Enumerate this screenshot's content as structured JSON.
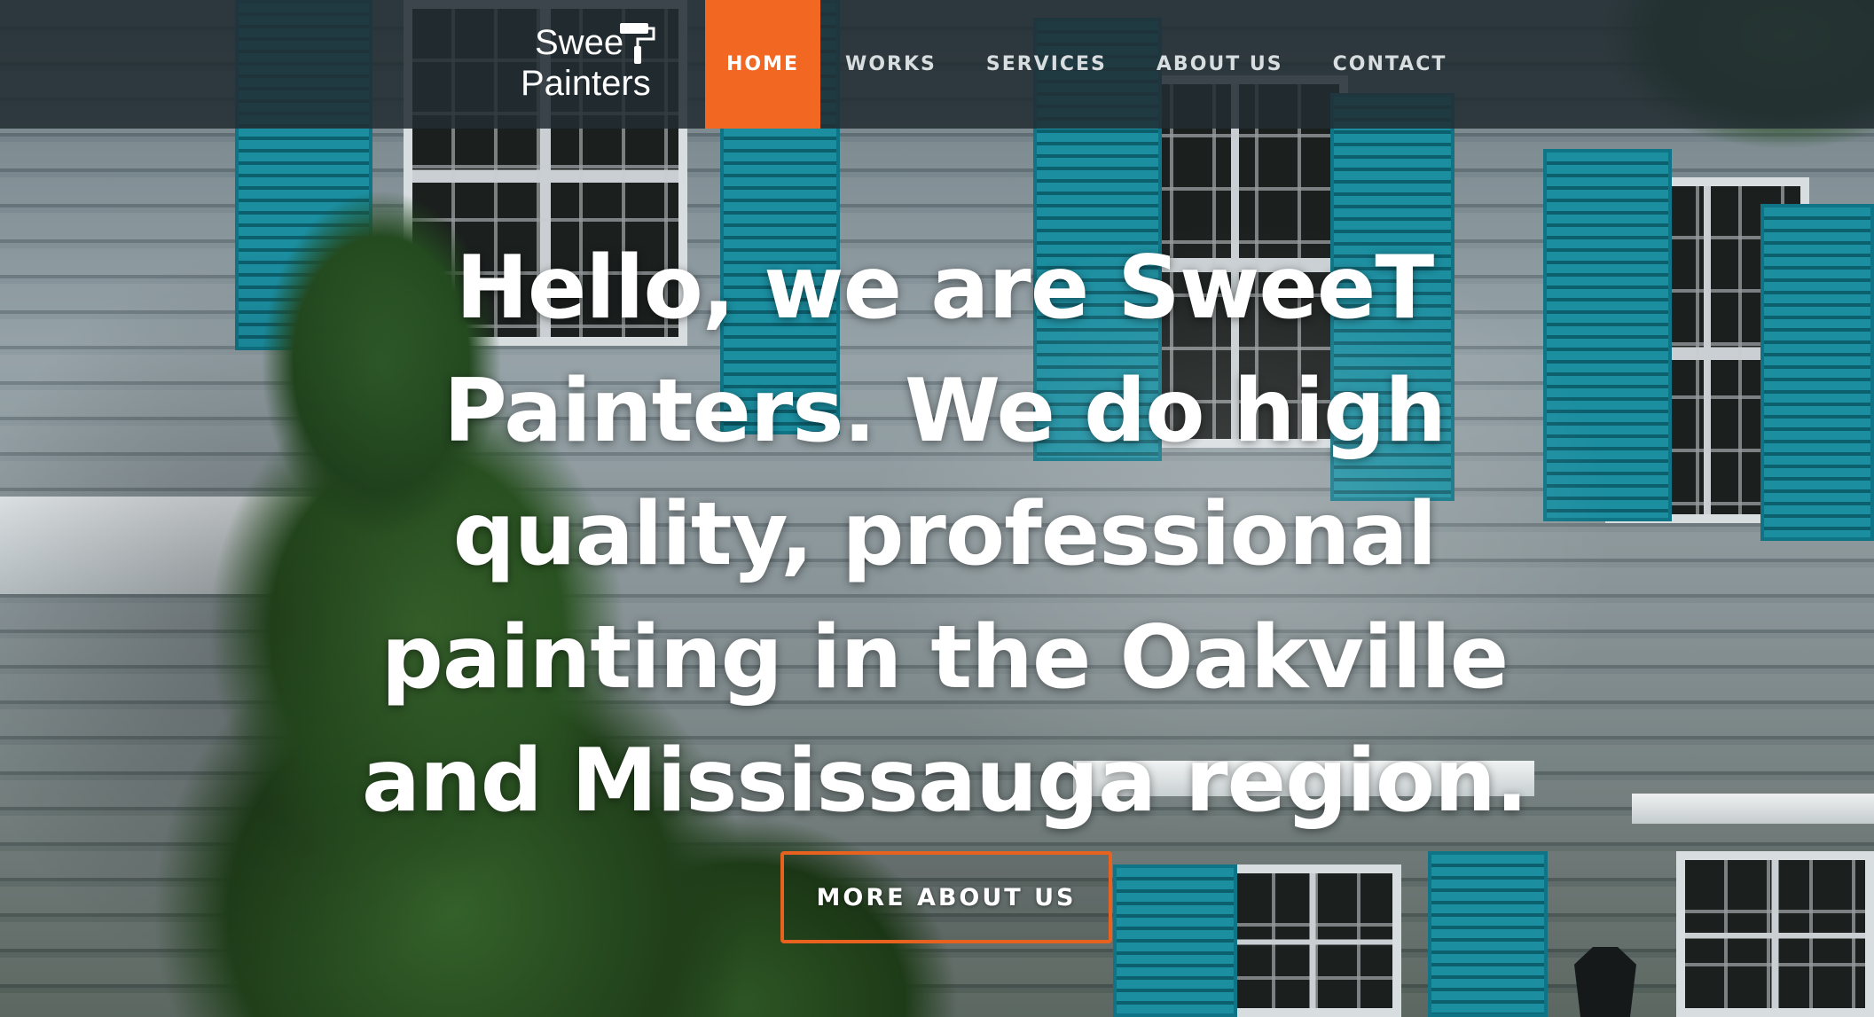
{
  "brand": {
    "name_line1": "Swee",
    "name_line2": "Painters",
    "logo_icon": "paint-roller-icon"
  },
  "nav": {
    "items": [
      {
        "label": "HOME",
        "active": true
      },
      {
        "label": "WORKS",
        "active": false
      },
      {
        "label": "SERVICES",
        "active": false
      },
      {
        "label": "ABOUT US",
        "active": false
      },
      {
        "label": "CONTACT",
        "active": false
      }
    ]
  },
  "hero": {
    "headline": "Hello, we are SweeT Painters. We do high quality, professional painting in the Oakville and Mississauga region.",
    "cta_label": "MORE ABOUT US"
  },
  "colors": {
    "accent": "#f26722",
    "nav_background": "#222c32",
    "text": "#ffffff",
    "shutter": "#1b8ea0"
  }
}
